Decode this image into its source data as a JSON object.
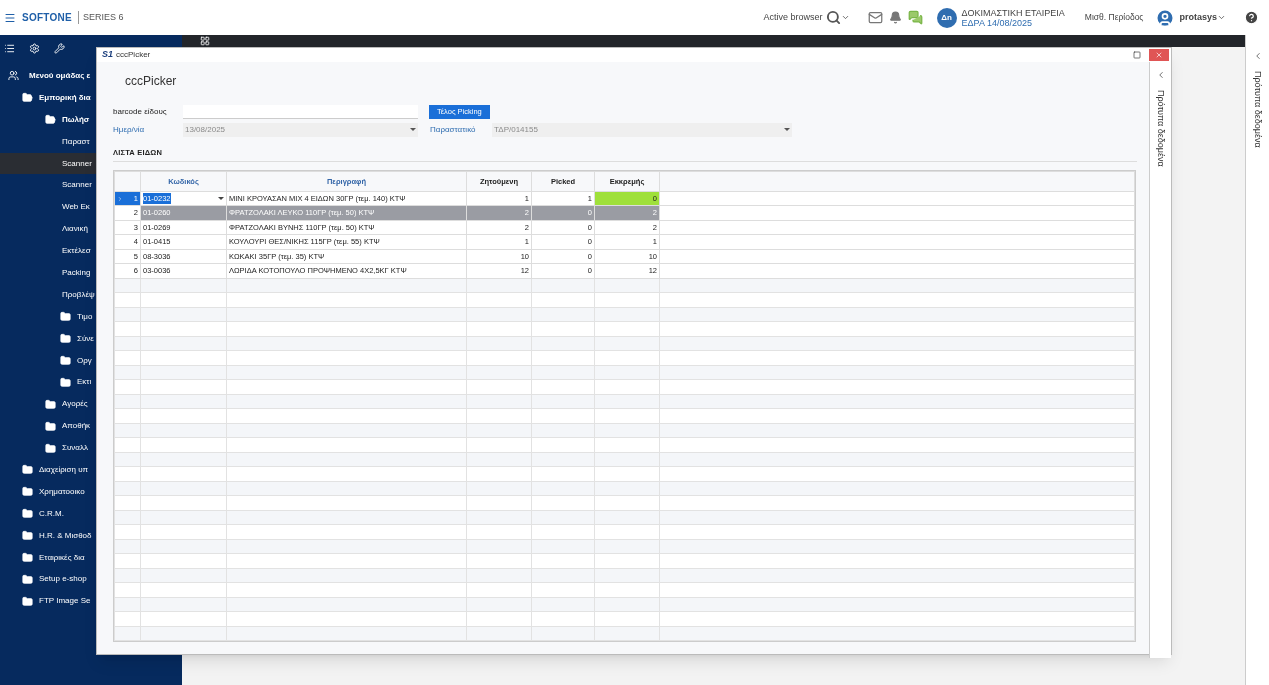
{
  "top_bar": {
    "logo": "SOFTONE",
    "edition": "SERIES 6",
    "browser_label": "Active browser",
    "company": {
      "initials": "Δn",
      "name": "ΔΟΚΙΜΑΣΤΙΚΗ ΕΤΑΙΡΕΙΑ",
      "branch": "ΕΔΡΑ 14/08/2025"
    },
    "period": "Μισθ. Περίοδος",
    "user": "protasys"
  },
  "sidebar": {
    "items": [
      {
        "label": "Μενού ομάδας ε",
        "kind": "group",
        "children": [
          {
            "label": "Εμπορική δια",
            "kind": "folder",
            "expanded": true,
            "children": [
              {
                "label": "Πωλήσ",
                "kind": "folder",
                "expanded": true,
                "children": [
                  {
                    "label": "Παραστ",
                    "kind": "item",
                    "selected": false
                  },
                  {
                    "label": "Scanner",
                    "kind": "item",
                    "selected": true
                  },
                  {
                    "label": "Scanner",
                    "kind": "item",
                    "selected": false
                  },
                  {
                    "label": "Web Εκ",
                    "kind": "item",
                    "selected": false
                  },
                  {
                    "label": "Λιανική",
                    "kind": "item",
                    "selected": false
                  },
                  {
                    "label": "Εκτέλεσ",
                    "kind": "item",
                    "selected": false
                  },
                  {
                    "label": "Packing",
                    "kind": "item",
                    "selected": false
                  },
                  {
                    "label": "Προβλέψ",
                    "kind": "item",
                    "selected": false
                  },
                  {
                    "label": "Τιμο",
                    "kind": "folder",
                    "expanded": false
                  },
                  {
                    "label": "Σύνε",
                    "kind": "folder",
                    "expanded": false
                  },
                  {
                    "label": "Οργ",
                    "kind": "folder",
                    "expanded": false
                  },
                  {
                    "label": "Εκτι",
                    "kind": "folder",
                    "expanded": false
                  }
                ]
              },
              {
                "label": "Αγορές",
                "kind": "folder",
                "expanded": false
              },
              {
                "label": "Αποθήκ",
                "kind": "folder",
                "expanded": false
              },
              {
                "label": "Συναλλ",
                "kind": "folder",
                "expanded": false
              }
            ]
          },
          {
            "label": "Διαχείριση υπ",
            "kind": "folder",
            "expanded": false
          },
          {
            "label": "Χρηματοοικο",
            "kind": "folder",
            "expanded": false
          },
          {
            "label": "C.R.M.",
            "kind": "folder",
            "expanded": false
          },
          {
            "label": "H.R. & Μισθοδ",
            "kind": "folder",
            "expanded": false
          },
          {
            "label": "Εταιρικές δια",
            "kind": "folder",
            "expanded": false
          },
          {
            "label": "Setup e-shop",
            "kind": "folder",
            "expanded": false
          },
          {
            "label": "FTP Image Se",
            "kind": "folder",
            "expanded": false
          }
        ]
      }
    ]
  },
  "side_panel": {
    "label": "Πρότυπα δεδομένα"
  },
  "dialog": {
    "app_logo": "S1",
    "title": "cccPicker",
    "heading": "cccPicker",
    "barcode": {
      "label": "barcode είδους"
    },
    "finish_button": "Τέλος Picking",
    "date": {
      "label": "Ημερ/νία",
      "value": "13/08/2025",
      "disabled": true
    },
    "document": {
      "label": "Παραστατικό",
      "value": "ΤΔΡ/014155",
      "disabled": true
    },
    "section_title": "ΛΙΣΤΑ ΕΙΔΩΝ",
    "side_panel": {
      "label": "Πρότυπα δεδομένα"
    },
    "table": {
      "columns": [
        "Κωδικός",
        "Περιγραφή",
        "Ζητούμενη",
        "Picked",
        "Εκκρεμής"
      ],
      "rows": [
        {
          "number": "1",
          "code": "01-0232",
          "description": "ΜΙΝΙ ΚΡΟΥΑΣΑΝ ΜΙΧ 4 ΕΙΔΩΝ 30ΓΡ (τεμ. 140) ΚΤΨ",
          "requested": "1",
          "picked": "1",
          "pending": "0",
          "current": true,
          "selected": false,
          "complete": true
        },
        {
          "number": "2",
          "code": "01-0260",
          "description": "ΦΡΑΤΖΟΛΑΚΙ ΛΕΥΚΟ 110ΓΡ (τεμ. 50) ΚΤΨ",
          "requested": "2",
          "picked": "0",
          "pending": "2",
          "current": false,
          "selected": true,
          "complete": false
        },
        {
          "number": "3",
          "code": "01-0269",
          "description": "ΦΡΑΤΖΟΛΑΚΙ ΒΥΝΗΣ 110ΓΡ (τεμ. 50) ΚΤΨ",
          "requested": "2",
          "picked": "0",
          "pending": "2",
          "current": false,
          "selected": false,
          "complete": false
        },
        {
          "number": "4",
          "code": "01-0415",
          "description": "ΚΟΥΛΟΥΡΙ ΘΕΣ/ΝΙΚΗΣ 115ΓΡ (τεμ. 55) ΚΤΨ",
          "requested": "1",
          "picked": "0",
          "pending": "1",
          "current": false,
          "selected": false,
          "complete": false
        },
        {
          "number": "5",
          "code": "08-3036",
          "description": "ΚΩΚΑΚΙ 35ΓΡ (τεμ. 35) ΚΤΨ",
          "requested": "10",
          "picked": "0",
          "pending": "10",
          "current": false,
          "selected": false,
          "complete": false
        },
        {
          "number": "6",
          "code": "03-0036",
          "description": "ΛΩΡΙΔΑ ΚΟΤΟΠΟΥΛΟ ΠΡΟΨΗΜΕΝΟ 4Χ2,5ΚΓ ΚΤΨ",
          "requested": "12",
          "picked": "0",
          "pending": "12",
          "current": false,
          "selected": false,
          "complete": false
        }
      ]
    }
  }
}
